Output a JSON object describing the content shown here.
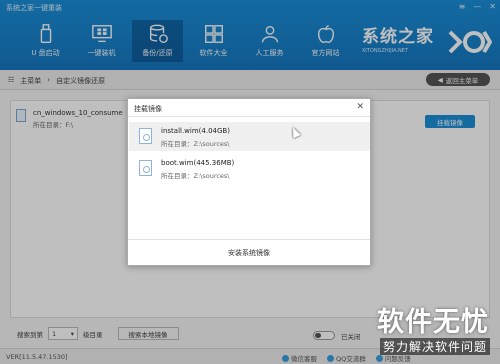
{
  "window": {
    "title": "系统之家一键重装",
    "controls": [
      "≡",
      "—",
      "✕"
    ]
  },
  "nav": [
    {
      "label": "U 盘启动",
      "icon": "usb-icon"
    },
    {
      "label": "一键装机",
      "icon": "monitor-icon"
    },
    {
      "label": "备份/还原",
      "icon": "database-icon",
      "active": true
    },
    {
      "label": "软件大全",
      "icon": "apps-icon"
    },
    {
      "label": "人工服务",
      "icon": "person-icon"
    },
    {
      "label": "官方网站",
      "icon": "apple-icon"
    }
  ],
  "brand": {
    "name": "系统之家",
    "url": "XITONGZHIJIA.NET"
  },
  "breadcrumb": {
    "items": [
      "主菜单",
      "自定义镜像还原"
    ],
    "back_label": "返回主菜单"
  },
  "image_entry": {
    "name": "cn_windows_10_consume",
    "dir": "所在目录：F:\\",
    "mount_label": "挂载镜像"
  },
  "bottom": {
    "search_label": "搜索到第",
    "level": "1",
    "level_suffix": "级目录",
    "search_local_label": "搜索本地镜像",
    "toggle_label": "已关闭"
  },
  "status": {
    "version": "VER[11.5.47.1530]",
    "links": [
      "微信客服",
      "QQ交流群",
      "问题反馈"
    ]
  },
  "modal": {
    "title": "挂载镜像",
    "items": [
      {
        "name": "install.wim(4.04GB)",
        "path": "所在目录：Z:\\sources\\"
      },
      {
        "name": "boot.wim(445.36MB)",
        "path": "所在目录：Z:\\sources\\"
      }
    ],
    "install_label": "安装系统镜像"
  },
  "watermark": {
    "line1": "软件无忧",
    "line2": "努力解决软件问题"
  }
}
